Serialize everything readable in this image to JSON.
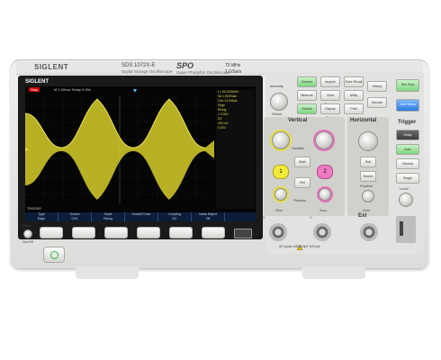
{
  "device": {
    "brand": "SIGLENT",
    "model": "SDS 1072X-E",
    "model_sub": "Digital Storage Oscilloscope",
    "spo_logo": "SPO",
    "spo_sub": "Super Phosphor Oscilloscope",
    "bandwidth": "70 MHz",
    "sample_rate": "1 GSa/s"
  },
  "screen": {
    "top_left": "Stop",
    "top_status": "M 1.00ms/ Delay 0.00s",
    "right_lines": [
      "f = 54.2240kHz",
      "Sa 1.00GSa/s",
      "Curr 14.0Mpts",
      "Edge",
      "Rising",
      "1 0.00V",
      "DC",
      "400 mV",
      "0.00V"
    ],
    "bottom_label": "TRIGGER",
    "softkeys": [
      {
        "title": "Type",
        "value": "Edge"
      },
      {
        "title": "Source",
        "value": "CH1"
      },
      {
        "title": "Slope",
        "value": "Rising"
      },
      {
        "title": "Holdoff Close",
        "value": ""
      },
      {
        "title": "Coupling",
        "value": "DC"
      },
      {
        "title": "Noise Reject",
        "value": "Off"
      }
    ]
  },
  "controls": {
    "menu_label": "Menu",
    "onoff_label": "On/Off",
    "intensity_label": "Intensity",
    "adjust_label": "Adjust",
    "select_label": "Select",
    "vertical_label": "Vertical",
    "horizontal_label": "Horizontal",
    "trigger_label": "Trigger",
    "variable_label": "Variable",
    "position_label": "Position",
    "zero_label": "Zero",
    "roll_label": "Roll",
    "search_label": "Search",
    "level_label": "Level",
    "ch1_label": "1",
    "ch2_label": "2",
    "ext_label": "Ext",
    "x_label": "X",
    "y_label": "Y",
    "warning_label": "All Inputs 1MΩ||15pF 400Vpk",
    "top_buttons": [
      "Cursors",
      "Acquire",
      "Save Recall",
      "History",
      "Measure",
      "Clear Sweeps",
      "Utility",
      "Default",
      "Display Persist",
      "Print",
      "Decode"
    ],
    "side_buttons": [
      "Run Stop",
      "Auto Setup"
    ],
    "math_label": "Math",
    "ref_label": "Ref",
    "trigger_buttons": [
      "Setup",
      "Auto",
      "Normal",
      "Single"
    ]
  },
  "colors": {
    "ch1": "#e6e03a",
    "ch2": "#e86bb8",
    "green": "#7fd67f",
    "blue": "#2d7ae0"
  }
}
